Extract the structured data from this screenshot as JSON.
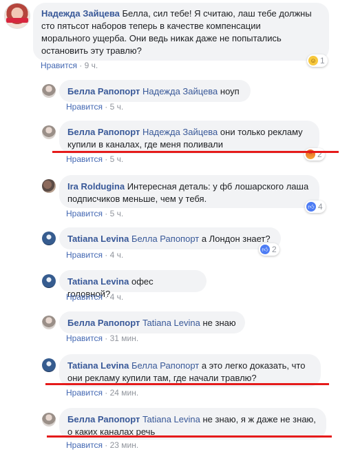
{
  "comments": [
    {
      "author": "Надежда Зайцева",
      "lines": [
        "Белла, сил тебе! Я считаю, лаш тебе должны",
        "сто пятьсот наборов теперь в качестве компенсации",
        "морального ущерба. Они ведь никак даже не попытались",
        "остановить эту травлю?"
      ],
      "like_label": "Нравится",
      "time": "9 ч.",
      "reaction_count": "1"
    },
    {
      "author": "Белла Рапопорт",
      "mention": "Надежда Зайцева",
      "text": "ноуп",
      "like_label": "Нравится",
      "time": "5 ч."
    },
    {
      "author": "Белла Рапопорт",
      "mention": "Надежда Зайцева",
      "text1": "они только рекламу",
      "text2": "купили в каналах, где меня поливали",
      "like_label": "Нравится",
      "time": "5 ч.",
      "reaction_count": "2"
    },
    {
      "author": "Ira Roldugina",
      "text1": "Интересная деталь: у фб лошарского лаша",
      "text2": "подписчиков меньше, чем у тебя.",
      "like_label": "Нравится",
      "time": "5 ч.",
      "reaction_count": "4"
    },
    {
      "author": "Tatiana Levina",
      "mention": "Белла Рапопорт",
      "text": "а Лондон знает?",
      "like_label": "Нравится",
      "time": "4 ч.",
      "reaction_count": "2"
    },
    {
      "author": "Tatiana Levina",
      "text": "офес головной?",
      "like_label": "Нравится",
      "time": "4 ч."
    },
    {
      "author": "Белла Рапопорт",
      "mention": "Tatiana Levina",
      "text": "не знаю",
      "like_label": "Нравится",
      "time": "31 мин."
    },
    {
      "author": "Tatiana Levina",
      "mention": "Белла Рапопорт",
      "text1": "а это легко доказать, что",
      "text2": "они рекламу купили там, где начали травлю?",
      "like_label": "Нравится",
      "time": "24 мин."
    },
    {
      "author": "Белла Рапопорт",
      "mention": "Tatiana Levina",
      "text1": "не знаю, я ж даже не знаю,",
      "text2": "о каких каналах речь",
      "like_label": "Нравится",
      "time": "23 мин."
    }
  ],
  "colors": {
    "link": "#385898",
    "bubble": "#f2f3f5",
    "meta": "#90949c",
    "underline": "#e51a1a"
  },
  "icons": {
    "haha": "haha-reaction-icon",
    "angry": "angry-reaction-icon",
    "like": "like-reaction-icon"
  }
}
